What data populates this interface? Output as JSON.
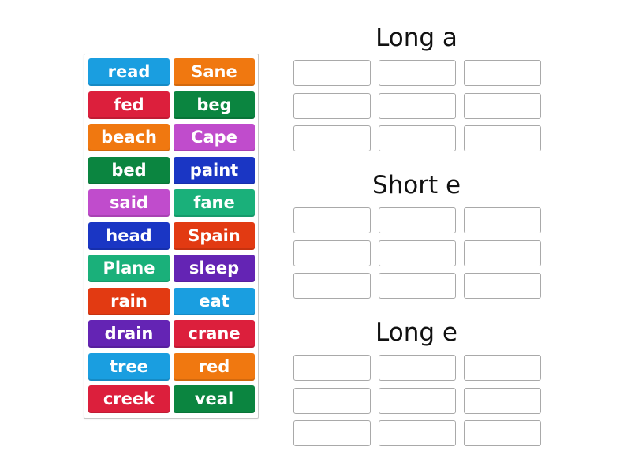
{
  "tiles": [
    {
      "label": "read",
      "color": "#1a9ee0"
    },
    {
      "label": "Sane",
      "color": "#f07810"
    },
    {
      "label": "fed",
      "color": "#dc1f3c"
    },
    {
      "label": "beg",
      "color": "#0b8540"
    },
    {
      "label": "beach",
      "color": "#f07810"
    },
    {
      "label": "Cape",
      "color": "#c04ccc"
    },
    {
      "label": "bed",
      "color": "#0b8540"
    },
    {
      "label": "paint",
      "color": "#1a36c4"
    },
    {
      "label": "said",
      "color": "#c04ccc"
    },
    {
      "label": "fane",
      "color": "#1ab07a"
    },
    {
      "label": "head",
      "color": "#1a36c4"
    },
    {
      "label": "Spain",
      "color": "#e23a12"
    },
    {
      "label": "Plane",
      "color": "#1ab07a"
    },
    {
      "label": "sleep",
      "color": "#6424b4"
    },
    {
      "label": "rain",
      "color": "#e23a12"
    },
    {
      "label": "eat",
      "color": "#1a9ee0"
    },
    {
      "label": "drain",
      "color": "#6424b4"
    },
    {
      "label": "crane",
      "color": "#dc1f3c"
    },
    {
      "label": "tree",
      "color": "#1a9ee0"
    },
    {
      "label": "red",
      "color": "#f07810"
    },
    {
      "label": "creek",
      "color": "#dc1f3c"
    },
    {
      "label": "veal",
      "color": "#0b8540"
    }
  ],
  "groups": [
    {
      "title": "Long a",
      "slots": 9
    },
    {
      "title": "Short e",
      "slots": 9
    },
    {
      "title": "Long e",
      "slots": 9
    }
  ]
}
